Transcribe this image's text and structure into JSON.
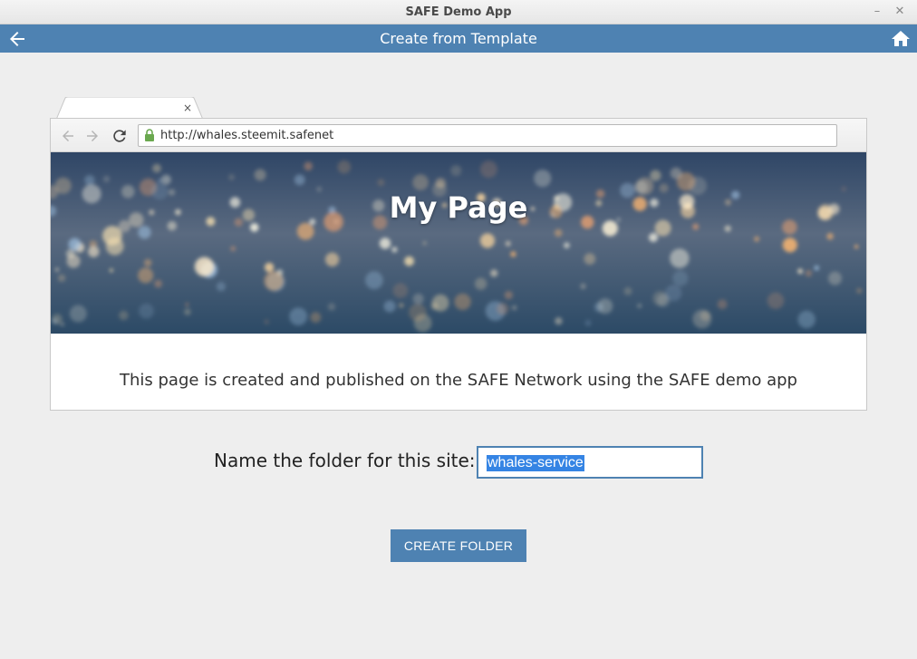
{
  "window": {
    "title": "SAFE Demo App",
    "min_glyph": "–",
    "close_glyph": "✕"
  },
  "header": {
    "title": "Create from Template",
    "back_icon": "back-arrow-icon",
    "home_icon": "home-icon",
    "color": "#4e82b2"
  },
  "browser": {
    "tab_close": "×",
    "url": "http://whales.steemit.safenet",
    "page_title": "My Page",
    "page_description": "This page is created and published on the SAFE Network using the SAFE demo app"
  },
  "form": {
    "label": "Name the folder for this site:",
    "folder_value": "whales-service",
    "create_button": "CREATE FOLDER"
  }
}
